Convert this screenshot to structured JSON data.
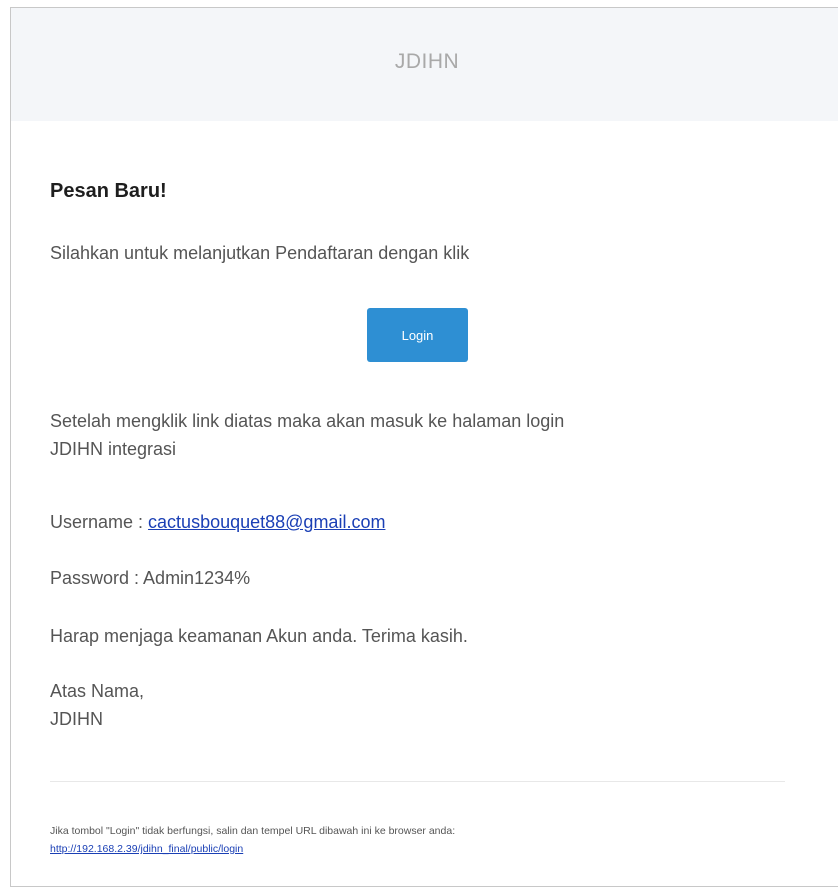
{
  "header": {
    "title": "JDIHN"
  },
  "body": {
    "heading": "Pesan Baru!",
    "intro": "Silahkan untuk melanjutkan Pendaftaran dengan klik",
    "login_button_label": "Login",
    "after_click_line1": "Setelah mengklik link diatas maka akan masuk ke halaman login",
    "after_click_line2": "JDIHN integrasi",
    "username_label": "Username : ",
    "username_value": "cactusbouquet88@gmail.com",
    "password_label": "Password : ",
    "password_value": "Admin1234%",
    "security_note": "Harap menjaga keamanan Akun anda. Terima kasih.",
    "signoff_line1": "Atas Nama,",
    "signoff_line2": "JDIHN"
  },
  "footer": {
    "note": "Jika tombol \"Login\" tidak berfungsi, salin dan tempel URL dibawah ini ke browser anda:",
    "url": "http://192.168.2.39/jdihn_final/public/login"
  },
  "colors": {
    "header_bg": "#f4f6f9",
    "button_bg": "#2e8fd3",
    "link": "#1a3fb5"
  }
}
